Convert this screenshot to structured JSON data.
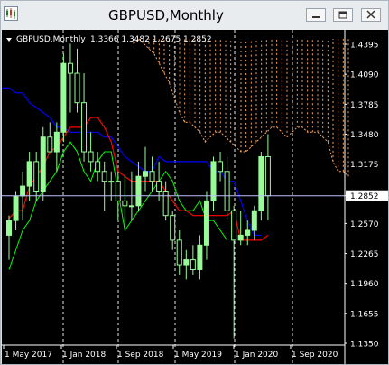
{
  "window": {
    "title": "GBPUSD,Monthly",
    "controls": [
      "minimize",
      "restore",
      "close"
    ]
  },
  "chart_data": {
    "type": "candlestick",
    "symbol": "GBPUSD",
    "timeframe": "Monthly",
    "ohlc_label": "1.3366 1.3482 1.2675 1.2852",
    "current_price": 1.2852,
    "y_ticks": [
      1.4395,
      1.409,
      1.3785,
      1.348,
      1.3175,
      1.2852,
      1.257,
      1.2265,
      1.196,
      1.1655,
      1.135
    ],
    "x_labels": [
      "1 May 2017",
      "1 Jan 2018",
      "1 Sep 2018",
      "1 May 2019",
      "1 Jan 2020",
      "1 Sep 2020"
    ],
    "ylim": [
      1.13,
      1.46
    ],
    "grid": "vertical dotted at period separators",
    "colors": {
      "background": "#000000",
      "bull_candle": "#98fb98",
      "bear_candle": "#000000",
      "wick": "#98fb98",
      "tenkan": "#ff0000",
      "kijun": "#0000ff",
      "chikou": "#00ff00",
      "kumo": "#f4a460",
      "price_line": "#c0c0ff"
    },
    "candles": [
      {
        "o": 1.245,
        "h": 1.265,
        "l": 1.22,
        "c": 1.26
      },
      {
        "o": 1.26,
        "h": 1.29,
        "l": 1.25,
        "c": 1.285
      },
      {
        "o": 1.285,
        "h": 1.31,
        "l": 1.26,
        "c": 1.295
      },
      {
        "o": 1.295,
        "h": 1.33,
        "l": 1.28,
        "c": 1.32
      },
      {
        "o": 1.32,
        "h": 1.33,
        "l": 1.28,
        "c": 1.29
      },
      {
        "o": 1.29,
        "h": 1.355,
        "l": 1.28,
        "c": 1.345
      },
      {
        "o": 1.345,
        "h": 1.36,
        "l": 1.33,
        "c": 1.33
      },
      {
        "o": 1.33,
        "h": 1.36,
        "l": 1.31,
        "c": 1.35
      },
      {
        "o": 1.35,
        "h": 1.43,
        "l": 1.34,
        "c": 1.42
      },
      {
        "o": 1.42,
        "h": 1.44,
        "l": 1.37,
        "c": 1.41
      },
      {
        "o": 1.41,
        "h": 1.435,
        "l": 1.37,
        "c": 1.38
      },
      {
        "o": 1.38,
        "h": 1.41,
        "l": 1.32,
        "c": 1.33
      },
      {
        "o": 1.33,
        "h": 1.35,
        "l": 1.31,
        "c": 1.32
      },
      {
        "o": 1.32,
        "h": 1.33,
        "l": 1.3,
        "c": 1.31
      },
      {
        "o": 1.31,
        "h": 1.32,
        "l": 1.27,
        "c": 1.3
      },
      {
        "o": 1.3,
        "h": 1.31,
        "l": 1.28,
        "c": 1.3
      },
      {
        "o": 1.3,
        "h": 1.31,
        "l": 1.26,
        "c": 1.28
      },
      {
        "o": 1.28,
        "h": 1.305,
        "l": 1.25,
        "c": 1.275
      },
      {
        "o": 1.275,
        "h": 1.31,
        "l": 1.26,
        "c": 1.275
      },
      {
        "o": 1.275,
        "h": 1.32,
        "l": 1.27,
        "c": 1.305
      },
      {
        "o": 1.305,
        "h": 1.335,
        "l": 1.29,
        "c": 1.31
      },
      {
        "o": 1.31,
        "h": 1.325,
        "l": 1.29,
        "c": 1.3
      },
      {
        "o": 1.3,
        "h": 1.32,
        "l": 1.28,
        "c": 1.29
      },
      {
        "o": 1.29,
        "h": 1.3,
        "l": 1.26,
        "c": 1.265
      },
      {
        "o": 1.265,
        "h": 1.27,
        "l": 1.23,
        "c": 1.24
      },
      {
        "o": 1.24,
        "h": 1.25,
        "l": 1.205,
        "c": 1.215
      },
      {
        "o": 1.215,
        "h": 1.23,
        "l": 1.2,
        "c": 1.22
      },
      {
        "o": 1.22,
        "h": 1.235,
        "l": 1.205,
        "c": 1.21
      },
      {
        "o": 1.21,
        "h": 1.245,
        "l": 1.2,
        "c": 1.235
      },
      {
        "o": 1.235,
        "h": 1.29,
        "l": 1.22,
        "c": 1.28
      },
      {
        "o": 1.28,
        "h": 1.325,
        "l": 1.27,
        "c": 1.32
      },
      {
        "o": 1.32,
        "h": 1.33,
        "l": 1.3,
        "c": 1.31
      },
      {
        "o": 1.31,
        "h": 1.325,
        "l": 1.26,
        "c": 1.27
      },
      {
        "o": 1.27,
        "h": 1.275,
        "l": 1.14,
        "c": 1.24
      },
      {
        "o": 1.24,
        "h": 1.27,
        "l": 1.235,
        "c": 1.245
      },
      {
        "o": 1.245,
        "h": 1.26,
        "l": 1.235,
        "c": 1.25
      },
      {
        "o": 1.25,
        "h": 1.275,
        "l": 1.24,
        "c": 1.27
      },
      {
        "o": 1.27,
        "h": 1.33,
        "l": 1.26,
        "c": 1.325
      },
      {
        "o": 1.325,
        "h": 1.348,
        "l": 1.26,
        "c": 1.2852
      }
    ],
    "tenkan": [
      1.262,
      1.27,
      1.27,
      1.295,
      1.305,
      1.315,
      1.33,
      1.335,
      1.345,
      1.355,
      1.355,
      1.355,
      1.365,
      1.365,
      1.355,
      1.34,
      1.31,
      1.305,
      1.3,
      1.3,
      1.3,
      1.3,
      1.3,
      1.29,
      1.28,
      1.27,
      1.27,
      1.265,
      1.265,
      1.265,
      1.265,
      1.265,
      1.265,
      1.27,
      1.24,
      1.24,
      1.24,
      1.24,
      1.245
    ],
    "kijun": [
      1.395,
      1.395,
      1.39,
      1.39,
      1.38,
      1.375,
      1.37,
      1.365,
      1.355,
      1.355,
      1.35,
      1.35,
      1.35,
      1.35,
      1.35,
      1.345,
      1.345,
      1.335,
      1.325,
      1.32,
      1.315,
      1.31,
      1.31,
      1.325,
      1.32,
      1.32,
      1.32,
      1.32,
      1.32,
      1.32,
      1.32,
      1.31,
      1.31,
      1.3,
      1.3,
      1.28,
      1.26,
      1.245,
      1.245
    ],
    "chikou": [
      1.21,
      1.23,
      1.25,
      1.26,
      1.28,
      1.29,
      1.3,
      1.31,
      1.33,
      1.34,
      1.33,
      1.31,
      1.3,
      1.32,
      1.33,
      1.33,
      1.29,
      1.25,
      1.26,
      1.27,
      1.28,
      1.29,
      1.3,
      1.31,
      1.3,
      1.28,
      1.27,
      1.27,
      1.28,
      1.26,
      1.26,
      1.25,
      1.24
    ],
    "kumo_upper": [
      1.44,
      1.445,
      1.44,
      1.435,
      1.43,
      1.42,
      1.41,
      1.4,
      1.385,
      1.37,
      1.36,
      1.36,
      1.355,
      1.35,
      1.34,
      1.345,
      1.35,
      1.35,
      1.345,
      1.34,
      1.335,
      1.33,
      1.33,
      1.335,
      1.34,
      1.345,
      1.35,
      1.355,
      1.355,
      1.35,
      1.345,
      1.35,
      1.355,
      1.355,
      1.35,
      1.35,
      1.35,
      1.345,
      1.34,
      1.32,
      1.31,
      1.31,
      1.305
    ],
    "kumo_lower": [
      1.44,
      1.445,
      1.44,
      1.435,
      1.43,
      1.42,
      1.41,
      1.4,
      1.385,
      1.37,
      1.36,
      1.36,
      1.355,
      1.35,
      1.34,
      1.345,
      1.35,
      1.35,
      1.345,
      1.34,
      1.335,
      1.33,
      1.33,
      1.335,
      1.34,
      1.345,
      1.35,
      1.355,
      1.355,
      1.35,
      1.345,
      1.35,
      1.355,
      1.355,
      1.35,
      1.35,
      1.35,
      1.345,
      1.34,
      1.32,
      1.31,
      1.31,
      1.305
    ]
  }
}
